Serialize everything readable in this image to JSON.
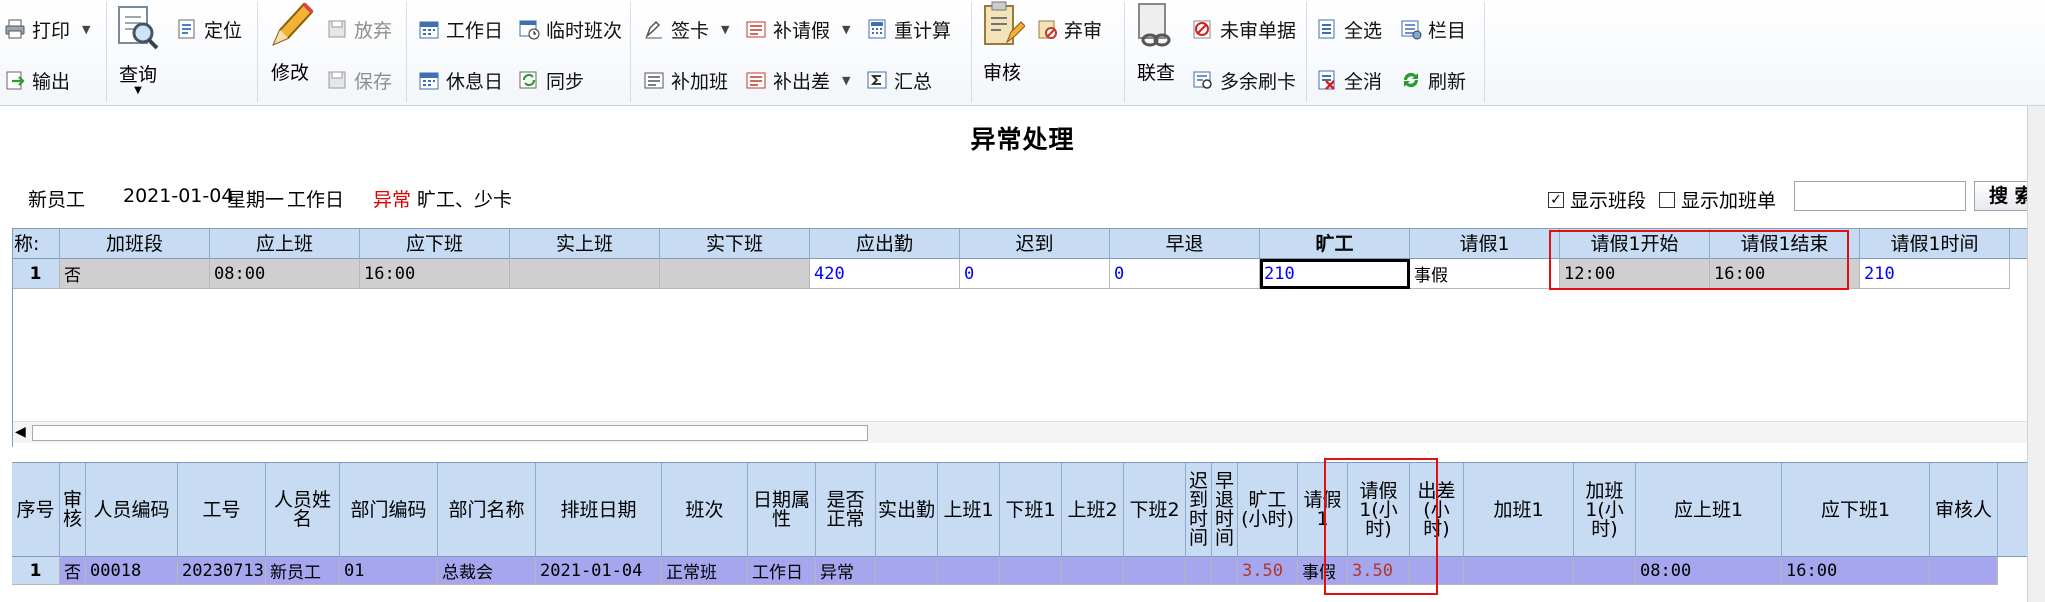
{
  "toolbar": {
    "print": "打印",
    "export": "输出",
    "query": "查询",
    "locate": "定位",
    "modify": "修改",
    "discard": "放弃",
    "save": "保存",
    "workday": "工作日",
    "restday": "休息日",
    "temp_shift": "临时班次",
    "sync": "同步",
    "sign_card": "签卡",
    "add_leave": "补请假",
    "add_overtime": "补加班",
    "add_trip": "补出差",
    "recalc": "重计算",
    "summary": "汇总",
    "review": "审核",
    "abandon_review": "弃审",
    "joint_query": "联查",
    "unreviewed": "未审单据",
    "extra_card": "多余刷卡",
    "select_all": "全选",
    "clear_all": "全消",
    "columns": "栏目",
    "refresh": "刷新"
  },
  "page_title": "异常处理",
  "info": {
    "employee": "新员工",
    "date": "2021-01-04",
    "weekday": "星期一",
    "day_type": "工作日",
    "status": "异常",
    "detail": "旷工、少卡",
    "show_shift_label": "显示班段",
    "show_shift_checked": true,
    "show_overtime_label": "显示加班单",
    "show_overtime_checked": false,
    "search_value": "",
    "search_button": "搜 索"
  },
  "upper_grid": {
    "corner": "称:",
    "columns": [
      "加班段",
      "应上班",
      "应下班",
      "实上班",
      "实下班",
      "应出勤",
      "迟到",
      "早退",
      "旷工",
      "请假1",
      "请假1开始",
      "请假1结束",
      "请假1时间"
    ],
    "rows": [
      {
        "no": "1",
        "cells": [
          "否",
          "08:00",
          "16:00",
          "",
          "",
          "420",
          "0",
          "0",
          "210",
          "事假",
          "12:00",
          "16:00",
          "210"
        ]
      }
    ]
  },
  "lower_grid": {
    "columns": [
      "序号",
      "审核",
      "人员编码",
      "工号",
      "人员姓名",
      "部门编码",
      "部门名称",
      "排班日期",
      "班次",
      "日期属性",
      "是否正常",
      "实出勤",
      "上班1",
      "下班1",
      "上班2",
      "下班2",
      "迟到时间",
      "早退时间",
      "旷工(小时)",
      "请假1",
      "请假1(小时)",
      "出差(小时)",
      "加班1",
      "加班1(小时)",
      "应上班1",
      "应下班1",
      "审核人"
    ],
    "rows": [
      {
        "no": "1",
        "cells": [
          "否",
          "00018",
          "20230713",
          "新员工",
          "01",
          "总裁会",
          "2021-01-04",
          "正常班",
          "工作日",
          "异常",
          "",
          "",
          "",
          "",
          "",
          "",
          "",
          "3.50",
          "事假",
          "3.50",
          "",
          "",
          "",
          "08:00",
          "16:00",
          ""
        ]
      }
    ]
  }
}
